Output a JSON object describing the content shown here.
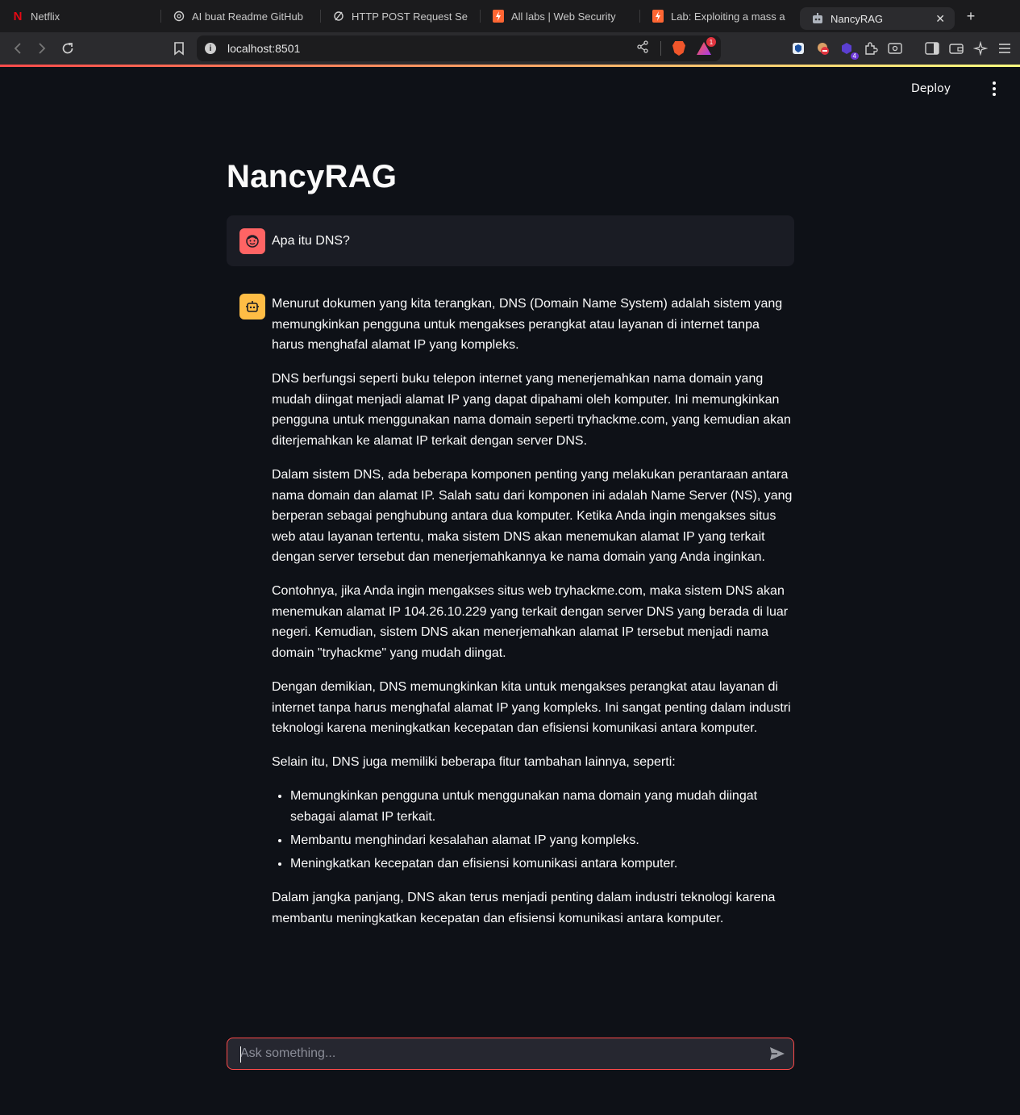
{
  "browser": {
    "tabs": [
      {
        "title": "Netflix",
        "icon": "netflix-icon",
        "active": false
      },
      {
        "title": "AI buat Readme GitHub",
        "icon": "openai-icon",
        "active": false
      },
      {
        "title": "HTTP POST Request Se",
        "icon": "link-icon",
        "active": false
      },
      {
        "title": "All labs | Web Security",
        "icon": "portswigger-icon",
        "active": false
      },
      {
        "title": "Lab: Exploiting a mass a",
        "icon": "portswigger-icon",
        "active": false
      },
      {
        "title": "NancyRAG",
        "icon": "robot-icon",
        "active": true
      }
    ],
    "url": "localhost:8501",
    "notification_badge": "1",
    "extension_badge": "4"
  },
  "app": {
    "deploy_label": "Deploy",
    "title": "NancyRAG",
    "user_message": "Apa itu DNS?",
    "assistant_paragraphs": [
      "Menurut dokumen yang kita terangkan, DNS (Domain Name System) adalah sistem yang memungkinkan pengguna untuk mengakses perangkat atau layanan di internet tanpa harus menghafal alamat IP yang kompleks.",
      "DNS berfungsi seperti buku telepon internet yang menerjemahkan nama domain yang mudah diingat menjadi alamat IP yang dapat dipahami oleh komputer. Ini memungkinkan pengguna untuk menggunakan nama domain seperti tryhackme.com, yang kemudian akan diterjemahkan ke alamat IP terkait dengan server DNS.",
      "Dalam sistem DNS, ada beberapa komponen penting yang melakukan perantaraan antara nama domain dan alamat IP. Salah satu dari komponen ini adalah Name Server (NS), yang berperan sebagai penghubung antara dua komputer. Ketika Anda ingin mengakses situs web atau layanan tertentu, maka sistem DNS akan menemukan alamat IP yang terkait dengan server tersebut dan menerjemahkannya ke nama domain yang Anda inginkan.",
      "Contohnya, jika Anda ingin mengakses situs web tryhackme.com, maka sistem DNS akan menemukan alamat IP 104.26.10.229 yang terkait dengan server DNS yang berada di luar negeri. Kemudian, sistem DNS akan menerjemahkan alamat IP tersebut menjadi nama domain \"tryhackme\" yang mudah diingat.",
      "Dengan demikian, DNS memungkinkan kita untuk mengakses perangkat atau layanan di internet tanpa harus menghafal alamat IP yang kompleks. Ini sangat penting dalam industri teknologi karena meningkatkan kecepatan dan efisiensi komunikasi antara komputer.",
      "Selain itu, DNS juga memiliki beberapa fitur tambahan lainnya, seperti:"
    ],
    "assistant_list": [
      "Memungkinkan pengguna untuk menggunakan nama domain yang mudah diingat sebagai alamat IP terkait.",
      "Membantu menghindari kesalahan alamat IP yang kompleks.",
      "Meningkatkan kecepatan dan efisiensi komunikasi antara komputer."
    ],
    "assistant_closing": "Dalam jangka panjang, DNS akan terus menjadi penting dalam industri teknologi karena membantu meningkatkan kecepatan dan efisiensi komunikasi antara komputer.",
    "chat_input": {
      "placeholder": "Ask something...",
      "value": ""
    }
  },
  "colors": {
    "background": "#0e1117",
    "accent": "#ff4b4b",
    "user_avatar": "#ff6464",
    "assistant_avatar": "#ffbd45",
    "user_bubble": "#1a1c24"
  }
}
